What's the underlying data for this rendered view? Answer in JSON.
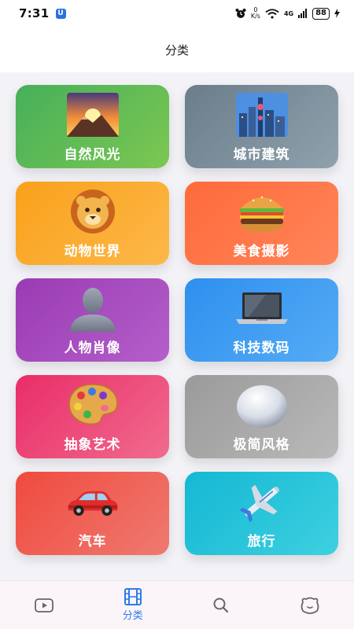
{
  "status_bar": {
    "time": "7:31",
    "app_badge": "U",
    "net_speed_value": "0",
    "net_speed_unit": "K/s",
    "network": "4G",
    "battery": "88"
  },
  "header": {
    "title": "分类"
  },
  "categories": [
    {
      "label": "自然风光",
      "icon": "sunrise-mountain-icon",
      "color": "#46b05a"
    },
    {
      "label": "城市建筑",
      "icon": "city-skyline-icon",
      "color": "#6b7d8a"
    },
    {
      "label": "动物世界",
      "icon": "lion-face-icon",
      "color": "#f9a11b"
    },
    {
      "label": "美食摄影",
      "icon": "hamburger-icon",
      "color": "#ff6a3a"
    },
    {
      "label": "人物肖像",
      "icon": "person-silhouette-icon",
      "color": "#9a3bb3"
    },
    {
      "label": "科技数码",
      "icon": "laptop-icon",
      "color": "#2e8fef"
    },
    {
      "label": "抽象艺术",
      "icon": "artist-palette-icon",
      "color": "#e92d68"
    },
    {
      "label": "极简风格",
      "icon": "white-sphere-icon",
      "color": "#9a9a9a"
    },
    {
      "label": "汽车",
      "icon": "car-icon",
      "color": "#f04a3e"
    },
    {
      "label": "旅行",
      "icon": "airplane-icon",
      "color": "#14b8d4"
    }
  ],
  "tab_bar": {
    "active_color": "#2f7bea",
    "tabs": [
      {
        "icon": "video-icon",
        "label": ""
      },
      {
        "icon": "film-icon",
        "label": "分类",
        "active": true
      },
      {
        "icon": "search-icon",
        "label": ""
      },
      {
        "icon": "profile-face-icon",
        "label": ""
      }
    ]
  }
}
